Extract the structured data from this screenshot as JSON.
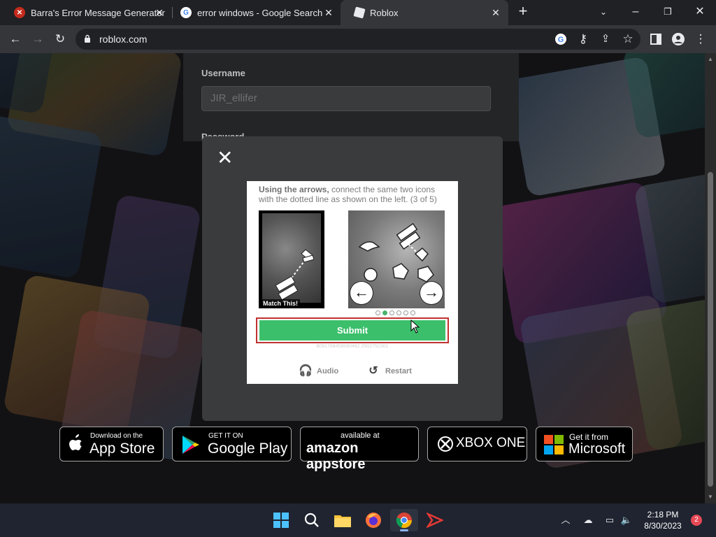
{
  "browser": {
    "tabs": [
      {
        "title": "Barra's Error Message Generator",
        "icon": "error-x-icon",
        "active": false
      },
      {
        "title": "error windows - Google Search",
        "icon": "google-g-icon",
        "active": false
      },
      {
        "title": "Roblox",
        "icon": "roblox-icon",
        "active": true
      }
    ],
    "new_tab_glyph": "+",
    "url": "roblox.com"
  },
  "login": {
    "username_label": "Username",
    "username_value": "JIR_ellifer",
    "password_label": "Password"
  },
  "captcha": {
    "instruction_bold": "Using the arrows,",
    "instruction_rest": " connect the same two icons with the dotted line as shown on the left. (3 of 5)",
    "reference_label": "Match This!",
    "submit_label": "Submit",
    "session_id": "8091768458080482.2502752301",
    "audio_label": "Audio",
    "restart_label": "Restart",
    "current_step": 2,
    "total_steps": 6,
    "colors": {
      "submit": "#3bbf6b",
      "highlight": "#c0312f"
    }
  },
  "store_badges": {
    "app_store": {
      "small": "Download on the",
      "big": "App Store"
    },
    "google_play": {
      "small": "GET IT ON",
      "big": "Google Play"
    },
    "amazon": {
      "small": "available at",
      "big": "amazon appstore"
    },
    "xbox": {
      "big": "XBOX ONE"
    },
    "microsoft": {
      "small": "Get it from",
      "big": "Microsoft"
    }
  },
  "taskbar": {
    "time": "2:18 PM",
    "date": "8/30/2023",
    "notification_count": "2"
  }
}
